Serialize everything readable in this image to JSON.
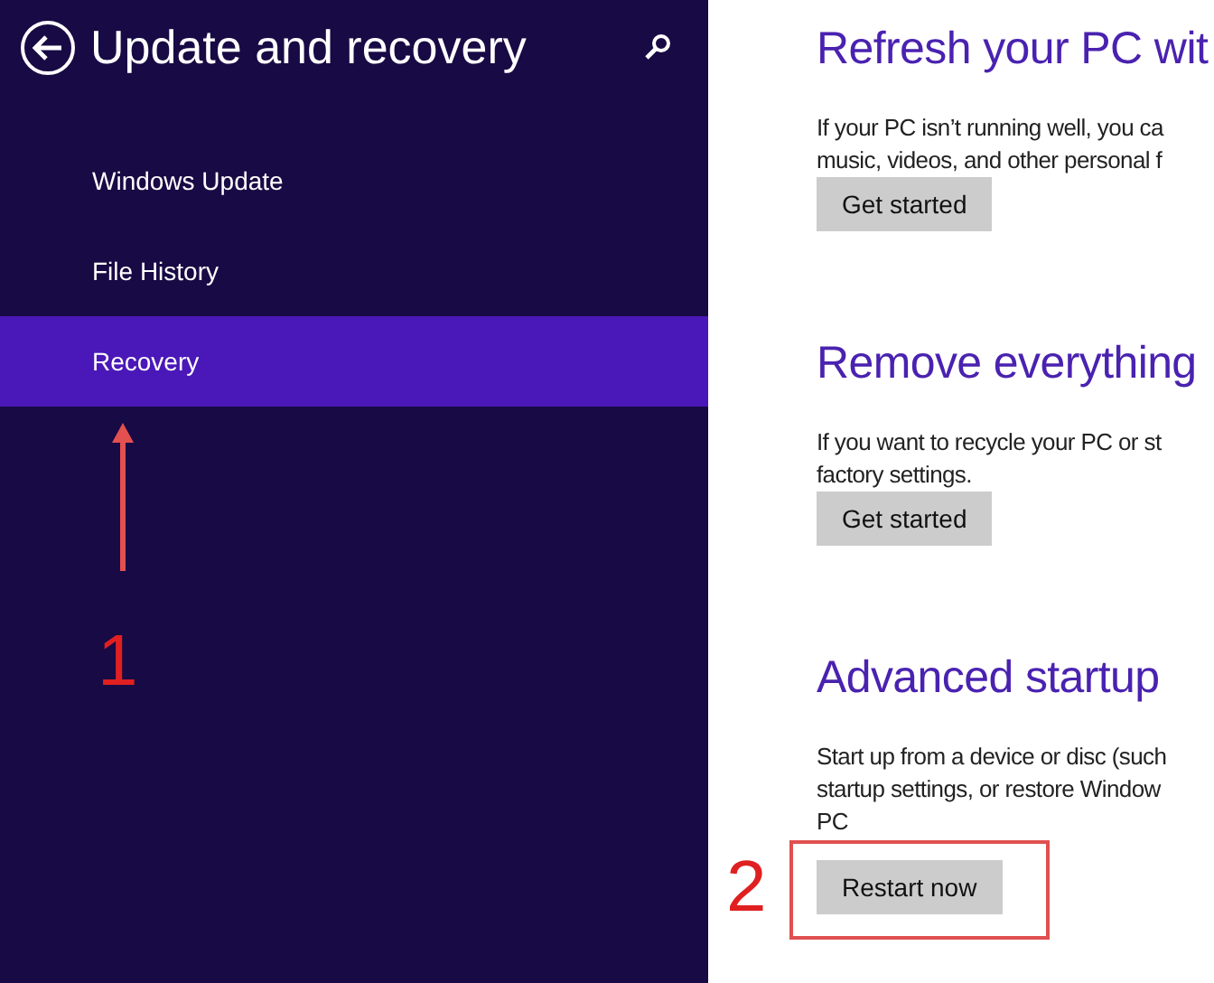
{
  "header": {
    "title": "Update and recovery"
  },
  "nav_items": [
    {
      "label": "Windows Update",
      "selected": false
    },
    {
      "label": "File History",
      "selected": false
    },
    {
      "label": "Recovery",
      "selected": true
    }
  ],
  "sections": [
    {
      "heading": "Refresh your PC wit",
      "lines": [
        "If your PC isn’t running well, you ca",
        "music, videos, and other personal f"
      ],
      "button": "Get started"
    },
    {
      "heading": "Remove everything",
      "lines": [
        "If you want to recycle your PC or st",
        "factory settings."
      ],
      "button": "Get started"
    },
    {
      "heading": "Advanced startup",
      "lines": [
        "Start up from a device or disc (such",
        "startup settings, or restore Window",
        "PC"
      ],
      "button": "Restart now"
    }
  ],
  "annotations": {
    "step_1": "1",
    "step_2": "2"
  }
}
